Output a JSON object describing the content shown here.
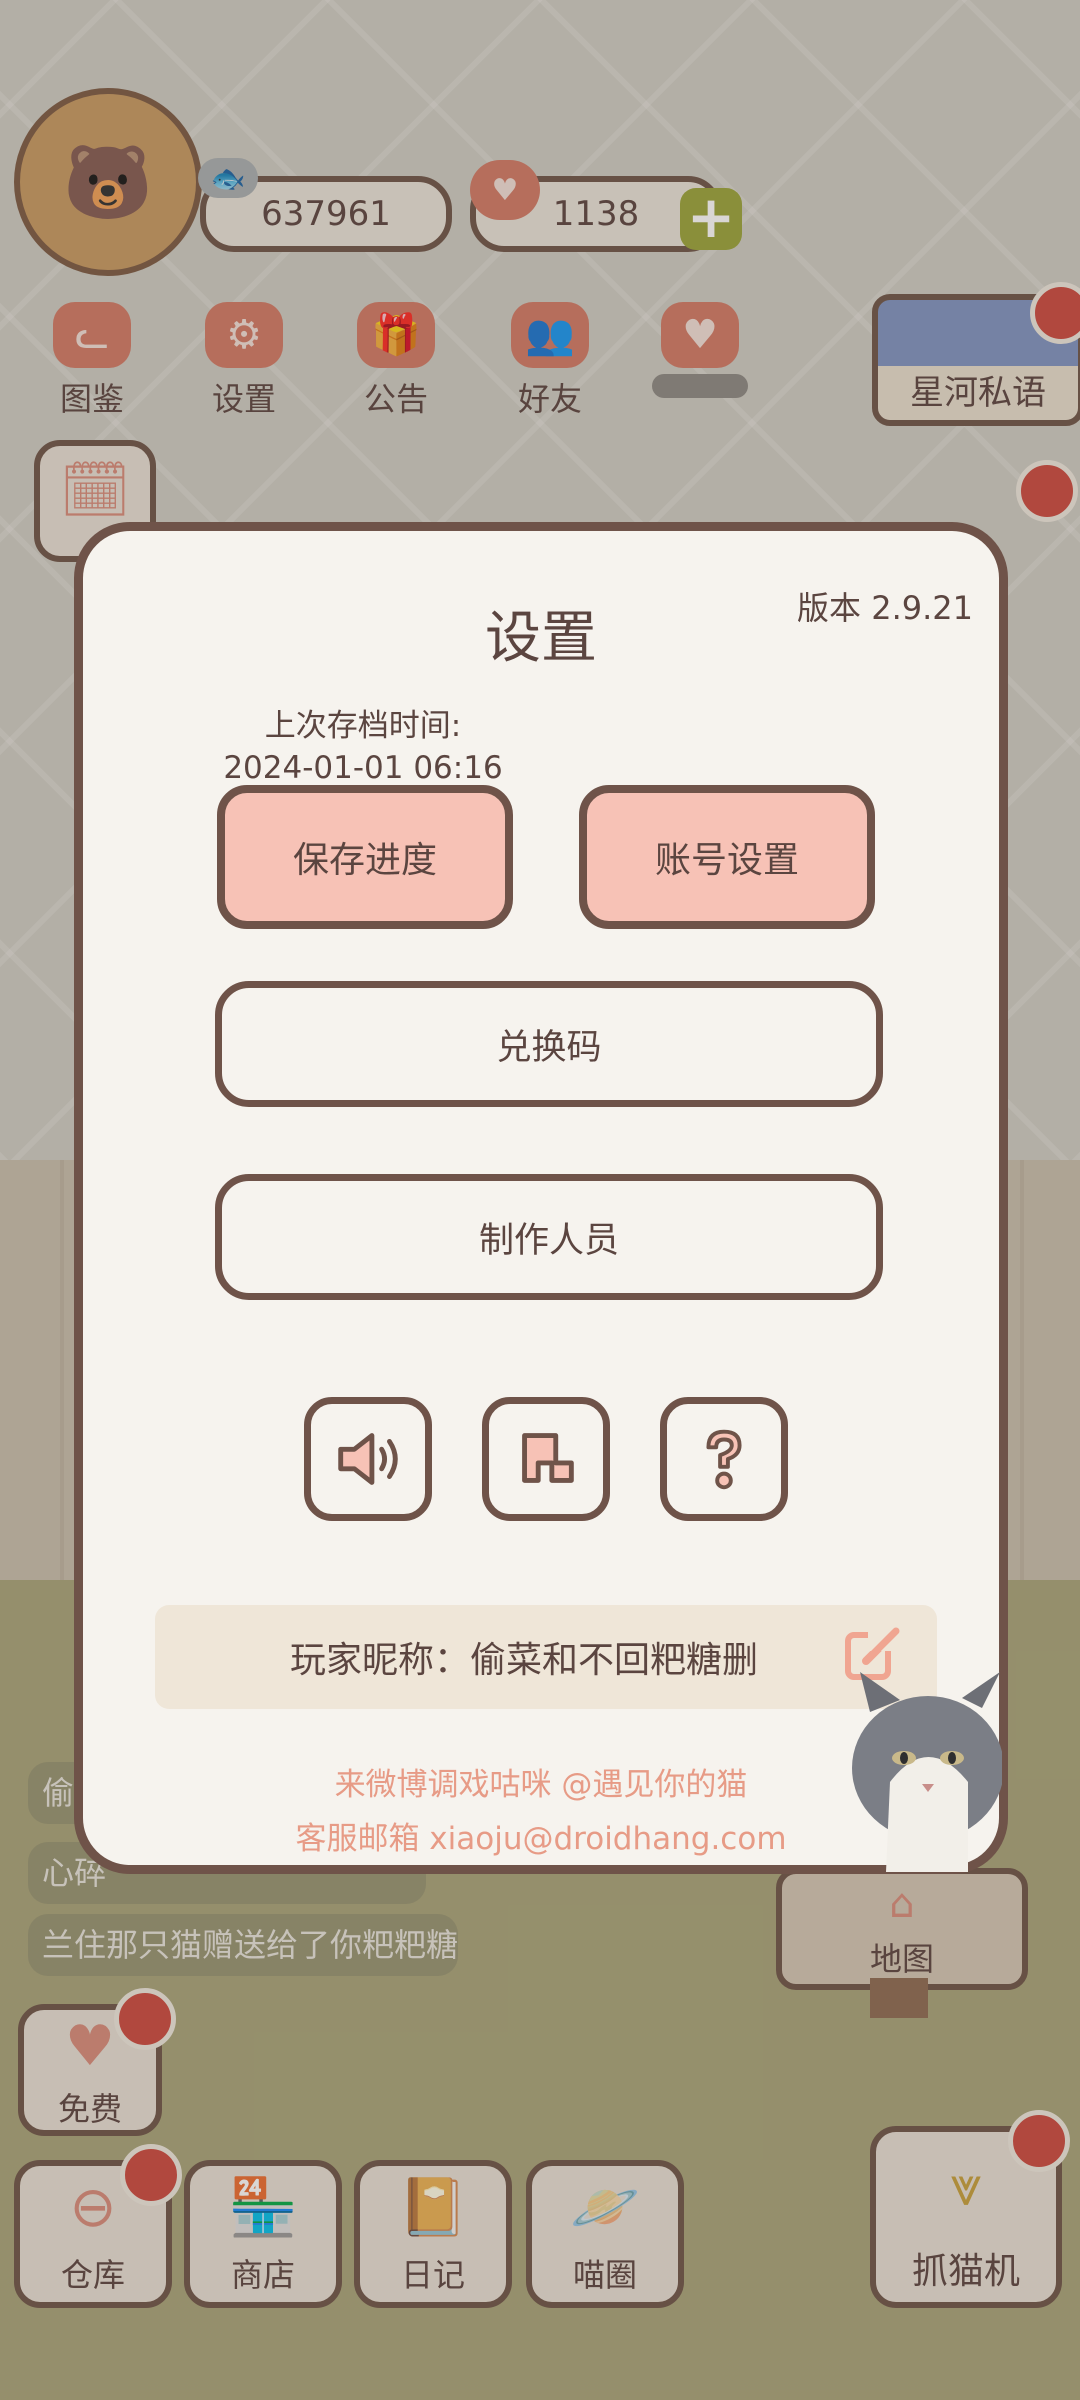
{
  "hud": {
    "coins": "637961",
    "hearts": "1138"
  },
  "top_menu": [
    {
      "label": "图鉴",
      "icon": "cat-head-icon"
    },
    {
      "label": "设置",
      "icon": "gear-icon"
    },
    {
      "label": "公告",
      "icon": "gift-icon"
    },
    {
      "label": "好友",
      "icon": "friends-icon"
    },
    {
      "label": "",
      "icon": "hearts-icon"
    }
  ],
  "banner": {
    "label": "星河私语"
  },
  "chat": [
    "偷",
    "心碎",
    "兰住那只猫赠送给了你粑粑糖"
  ],
  "map_sign": {
    "label": "地图"
  },
  "bottom_bar": {
    "free": "免费",
    "warehouse": "仓库",
    "shop": "商店",
    "diary": "日记",
    "cat_circle": "喵圈",
    "claw_machine": "抓猫机"
  },
  "dialog": {
    "title": "设置",
    "version": "版本 2.9.21",
    "last_save_label": "上次存档时间:",
    "last_save_time": "2024-01-01 06:16",
    "save_button": "保存进度",
    "account_button": "账号设置",
    "redeem_button": "兑换码",
    "credits_button": "制作人员",
    "nickname_label": "玩家昵称：",
    "nickname_value": "偷菜和不回粑糖删",
    "weibo_line": "来微博调戏咕咪 @遇见你的猫",
    "email_line": "客服邮箱 xiaoju@droidhang.com"
  },
  "colors": {
    "accent_pink": "#f7c2b6",
    "border_brown": "#6f5349",
    "dialog_bg": "#f6f3ee",
    "footer_text": "#e79b86",
    "badge_red": "#cc4a3f"
  }
}
